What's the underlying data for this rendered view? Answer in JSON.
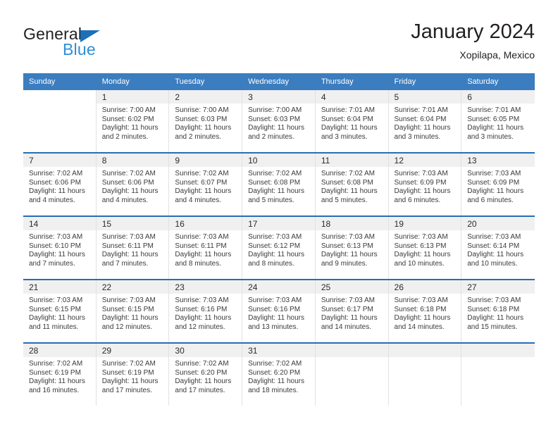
{
  "brand": {
    "name_top": "General",
    "name_bottom": "Blue",
    "triangle_color": "#1b70b8",
    "blue_text_color": "#2f8ed6"
  },
  "header": {
    "title": "January 2024",
    "subtitle": "Xopilapa, Mexico"
  },
  "theme": {
    "header_blue": "#3b7dbf",
    "row_divider_blue": "#2a6db3",
    "daynum_band_gray": "#f0f0f0"
  },
  "weekdays": [
    "Sunday",
    "Monday",
    "Tuesday",
    "Wednesday",
    "Thursday",
    "Friday",
    "Saturday"
  ],
  "labels": {
    "sunrise_prefix": "Sunrise:",
    "sunset_prefix": "Sunset:",
    "daylight_prefix": "Daylight:"
  },
  "weeks": [
    [
      {
        "day": "",
        "blank": true
      },
      {
        "day": "1",
        "line1": "Sunrise: 7:00 AM",
        "line2": "Sunset: 6:02 PM",
        "line3": "Daylight: 11 hours",
        "line4": "and 2 minutes."
      },
      {
        "day": "2",
        "line1": "Sunrise: 7:00 AM",
        "line2": "Sunset: 6:03 PM",
        "line3": "Daylight: 11 hours",
        "line4": "and 2 minutes."
      },
      {
        "day": "3",
        "line1": "Sunrise: 7:00 AM",
        "line2": "Sunset: 6:03 PM",
        "line3": "Daylight: 11 hours",
        "line4": "and 2 minutes."
      },
      {
        "day": "4",
        "line1": "Sunrise: 7:01 AM",
        "line2": "Sunset: 6:04 PM",
        "line3": "Daylight: 11 hours",
        "line4": "and 3 minutes."
      },
      {
        "day": "5",
        "line1": "Sunrise: 7:01 AM",
        "line2": "Sunset: 6:04 PM",
        "line3": "Daylight: 11 hours",
        "line4": "and 3 minutes."
      },
      {
        "day": "6",
        "line1": "Sunrise: 7:01 AM",
        "line2": "Sunset: 6:05 PM",
        "line3": "Daylight: 11 hours",
        "line4": "and 3 minutes."
      }
    ],
    [
      {
        "day": "7",
        "line1": "Sunrise: 7:02 AM",
        "line2": "Sunset: 6:06 PM",
        "line3": "Daylight: 11 hours",
        "line4": "and 4 minutes."
      },
      {
        "day": "8",
        "line1": "Sunrise: 7:02 AM",
        "line2": "Sunset: 6:06 PM",
        "line3": "Daylight: 11 hours",
        "line4": "and 4 minutes."
      },
      {
        "day": "9",
        "line1": "Sunrise: 7:02 AM",
        "line2": "Sunset: 6:07 PM",
        "line3": "Daylight: 11 hours",
        "line4": "and 4 minutes."
      },
      {
        "day": "10",
        "line1": "Sunrise: 7:02 AM",
        "line2": "Sunset: 6:08 PM",
        "line3": "Daylight: 11 hours",
        "line4": "and 5 minutes."
      },
      {
        "day": "11",
        "line1": "Sunrise: 7:02 AM",
        "line2": "Sunset: 6:08 PM",
        "line3": "Daylight: 11 hours",
        "line4": "and 5 minutes."
      },
      {
        "day": "12",
        "line1": "Sunrise: 7:03 AM",
        "line2": "Sunset: 6:09 PM",
        "line3": "Daylight: 11 hours",
        "line4": "and 6 minutes."
      },
      {
        "day": "13",
        "line1": "Sunrise: 7:03 AM",
        "line2": "Sunset: 6:09 PM",
        "line3": "Daylight: 11 hours",
        "line4": "and 6 minutes."
      }
    ],
    [
      {
        "day": "14",
        "line1": "Sunrise: 7:03 AM",
        "line2": "Sunset: 6:10 PM",
        "line3": "Daylight: 11 hours",
        "line4": "and 7 minutes."
      },
      {
        "day": "15",
        "line1": "Sunrise: 7:03 AM",
        "line2": "Sunset: 6:11 PM",
        "line3": "Daylight: 11 hours",
        "line4": "and 7 minutes."
      },
      {
        "day": "16",
        "line1": "Sunrise: 7:03 AM",
        "line2": "Sunset: 6:11 PM",
        "line3": "Daylight: 11 hours",
        "line4": "and 8 minutes."
      },
      {
        "day": "17",
        "line1": "Sunrise: 7:03 AM",
        "line2": "Sunset: 6:12 PM",
        "line3": "Daylight: 11 hours",
        "line4": "and 8 minutes."
      },
      {
        "day": "18",
        "line1": "Sunrise: 7:03 AM",
        "line2": "Sunset: 6:13 PM",
        "line3": "Daylight: 11 hours",
        "line4": "and 9 minutes."
      },
      {
        "day": "19",
        "line1": "Sunrise: 7:03 AM",
        "line2": "Sunset: 6:13 PM",
        "line3": "Daylight: 11 hours",
        "line4": "and 10 minutes."
      },
      {
        "day": "20",
        "line1": "Sunrise: 7:03 AM",
        "line2": "Sunset: 6:14 PM",
        "line3": "Daylight: 11 hours",
        "line4": "and 10 minutes."
      }
    ],
    [
      {
        "day": "21",
        "line1": "Sunrise: 7:03 AM",
        "line2": "Sunset: 6:15 PM",
        "line3": "Daylight: 11 hours",
        "line4": "and 11 minutes."
      },
      {
        "day": "22",
        "line1": "Sunrise: 7:03 AM",
        "line2": "Sunset: 6:15 PM",
        "line3": "Daylight: 11 hours",
        "line4": "and 12 minutes."
      },
      {
        "day": "23",
        "line1": "Sunrise: 7:03 AM",
        "line2": "Sunset: 6:16 PM",
        "line3": "Daylight: 11 hours",
        "line4": "and 12 minutes."
      },
      {
        "day": "24",
        "line1": "Sunrise: 7:03 AM",
        "line2": "Sunset: 6:16 PM",
        "line3": "Daylight: 11 hours",
        "line4": "and 13 minutes."
      },
      {
        "day": "25",
        "line1": "Sunrise: 7:03 AM",
        "line2": "Sunset: 6:17 PM",
        "line3": "Daylight: 11 hours",
        "line4": "and 14 minutes."
      },
      {
        "day": "26",
        "line1": "Sunrise: 7:03 AM",
        "line2": "Sunset: 6:18 PM",
        "line3": "Daylight: 11 hours",
        "line4": "and 14 minutes."
      },
      {
        "day": "27",
        "line1": "Sunrise: 7:03 AM",
        "line2": "Sunset: 6:18 PM",
        "line3": "Daylight: 11 hours",
        "line4": "and 15 minutes."
      }
    ],
    [
      {
        "day": "28",
        "line1": "Sunrise: 7:02 AM",
        "line2": "Sunset: 6:19 PM",
        "line3": "Daylight: 11 hours",
        "line4": "and 16 minutes."
      },
      {
        "day": "29",
        "line1": "Sunrise: 7:02 AM",
        "line2": "Sunset: 6:19 PM",
        "line3": "Daylight: 11 hours",
        "line4": "and 17 minutes."
      },
      {
        "day": "30",
        "line1": "Sunrise: 7:02 AM",
        "line2": "Sunset: 6:20 PM",
        "line3": "Daylight: 11 hours",
        "line4": "and 17 minutes."
      },
      {
        "day": "31",
        "line1": "Sunrise: 7:02 AM",
        "line2": "Sunset: 6:20 PM",
        "line3": "Daylight: 11 hours",
        "line4": "and 18 minutes."
      },
      {
        "day": "",
        "blank": true
      },
      {
        "day": "",
        "blank": true
      },
      {
        "day": "",
        "blank": true
      }
    ]
  ]
}
